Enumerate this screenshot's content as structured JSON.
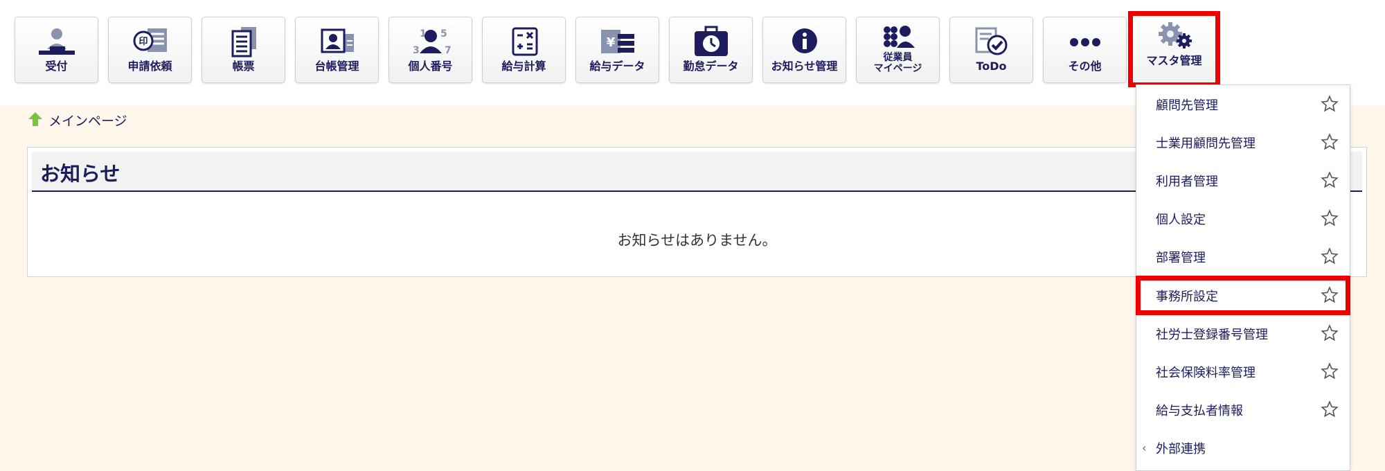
{
  "toolbar": {
    "buttons": [
      {
        "label": "受付",
        "icon": "reception-icon"
      },
      {
        "label": "申請依頼",
        "icon": "seal-document-icon"
      },
      {
        "label": "帳票",
        "icon": "forms-icon"
      },
      {
        "label": "台帳管理",
        "icon": "ledger-card-icon"
      },
      {
        "label": "個人番号",
        "icon": "personal-number-icon"
      },
      {
        "label": "給与計算",
        "icon": "calculator-icon"
      },
      {
        "label": "給与データ",
        "icon": "yen-data-icon"
      },
      {
        "label": "勤怠データ",
        "icon": "attendance-clock-icon"
      },
      {
        "label": "お知らせ管理",
        "icon": "info-icon"
      },
      {
        "label": "従業員\nマイページ",
        "icon": "employee-mypage-icon"
      },
      {
        "label": "ToDo",
        "icon": "todo-check-icon"
      },
      {
        "label": "その他",
        "icon": "more-dots-icon"
      },
      {
        "label": "マスタ管理",
        "icon": "gears-icon"
      }
    ]
  },
  "breadcrumb": {
    "home_label": "メインページ"
  },
  "notice": {
    "title": "お知らせ",
    "message": "お知らせはありません。"
  },
  "master_menu": {
    "items": [
      {
        "label": "顧問先管理"
      },
      {
        "label": "士業用顧問先管理"
      },
      {
        "label": "利用者管理"
      },
      {
        "label": "個人設定"
      },
      {
        "label": "部署管理"
      },
      {
        "label": "事務所設定"
      },
      {
        "label": "社労士登録番号管理"
      },
      {
        "label": "社会保険料率管理"
      },
      {
        "label": "給与支払者情報"
      }
    ],
    "submenu": {
      "label": "外部連携",
      "chevron": "‹"
    }
  },
  "colors": {
    "accent": "#1c1c5e",
    "highlight": "#ee0000",
    "background": "#fff7ec",
    "home_icon": "#7cc242"
  }
}
